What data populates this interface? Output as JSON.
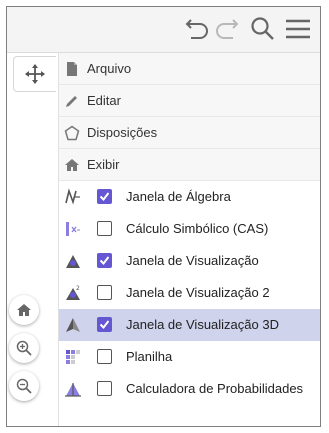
{
  "colors": {
    "accent": "#6557d2",
    "highlight_row": "#cfd3ec",
    "toolbar_bg": "#f4f4f4",
    "icon_gray": "#666666"
  },
  "toolbar": {
    "icons": [
      "undo-icon",
      "redo-icon",
      "search-icon",
      "hamburger-menu-icon"
    ]
  },
  "side_tools": [
    "move-tool-icon",
    "home-icon",
    "zoom-in-icon",
    "zoom-out-icon"
  ],
  "menu": {
    "items": [
      {
        "label": "Arquivo",
        "icon": "file-icon"
      },
      {
        "label": "Editar",
        "icon": "pencil-icon"
      },
      {
        "label": "Disposições",
        "icon": "layout-icon"
      },
      {
        "label": "Exibir",
        "icon": "home-icon"
      }
    ]
  },
  "view": {
    "items": [
      {
        "label": "Janela de Álgebra",
        "checked": true,
        "icon": "algebra-icon"
      },
      {
        "label": "Cálculo Simbólico (CAS)",
        "checked": false,
        "icon": "cas-icon"
      },
      {
        "label": "Janela de Visualização",
        "checked": true,
        "icon": "graphics-icon"
      },
      {
        "label": "Janela de Visualização 2",
        "checked": false,
        "icon": "graphics2-icon"
      },
      {
        "label": "Janela de Visualização 3D",
        "checked": true,
        "icon": "graphics3d-icon"
      },
      {
        "label": "Planilha",
        "checked": false,
        "icon": "spreadsheet-icon"
      },
      {
        "label": "Calculadora de Probabilidades",
        "checked": false,
        "icon": "probability-icon"
      }
    ]
  }
}
